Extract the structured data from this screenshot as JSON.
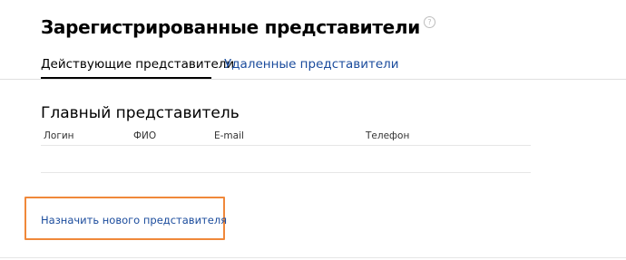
{
  "header": {
    "title": "Зарегистрированные представители",
    "help_icon_symbol": "?"
  },
  "tabs": [
    {
      "label": "Действующие представители",
      "active": true
    },
    {
      "label": "Удаленные представители",
      "active": false
    }
  ],
  "main_representative": {
    "section_title": "Главный представитель",
    "columns": [
      "Логин",
      "ФИО",
      "E-mail",
      "Телефон"
    ]
  },
  "actions": {
    "assign_new_label": "Назначить нового представителя"
  },
  "colors": {
    "link": "#1a4b9c",
    "highlight": "#f0883a"
  }
}
